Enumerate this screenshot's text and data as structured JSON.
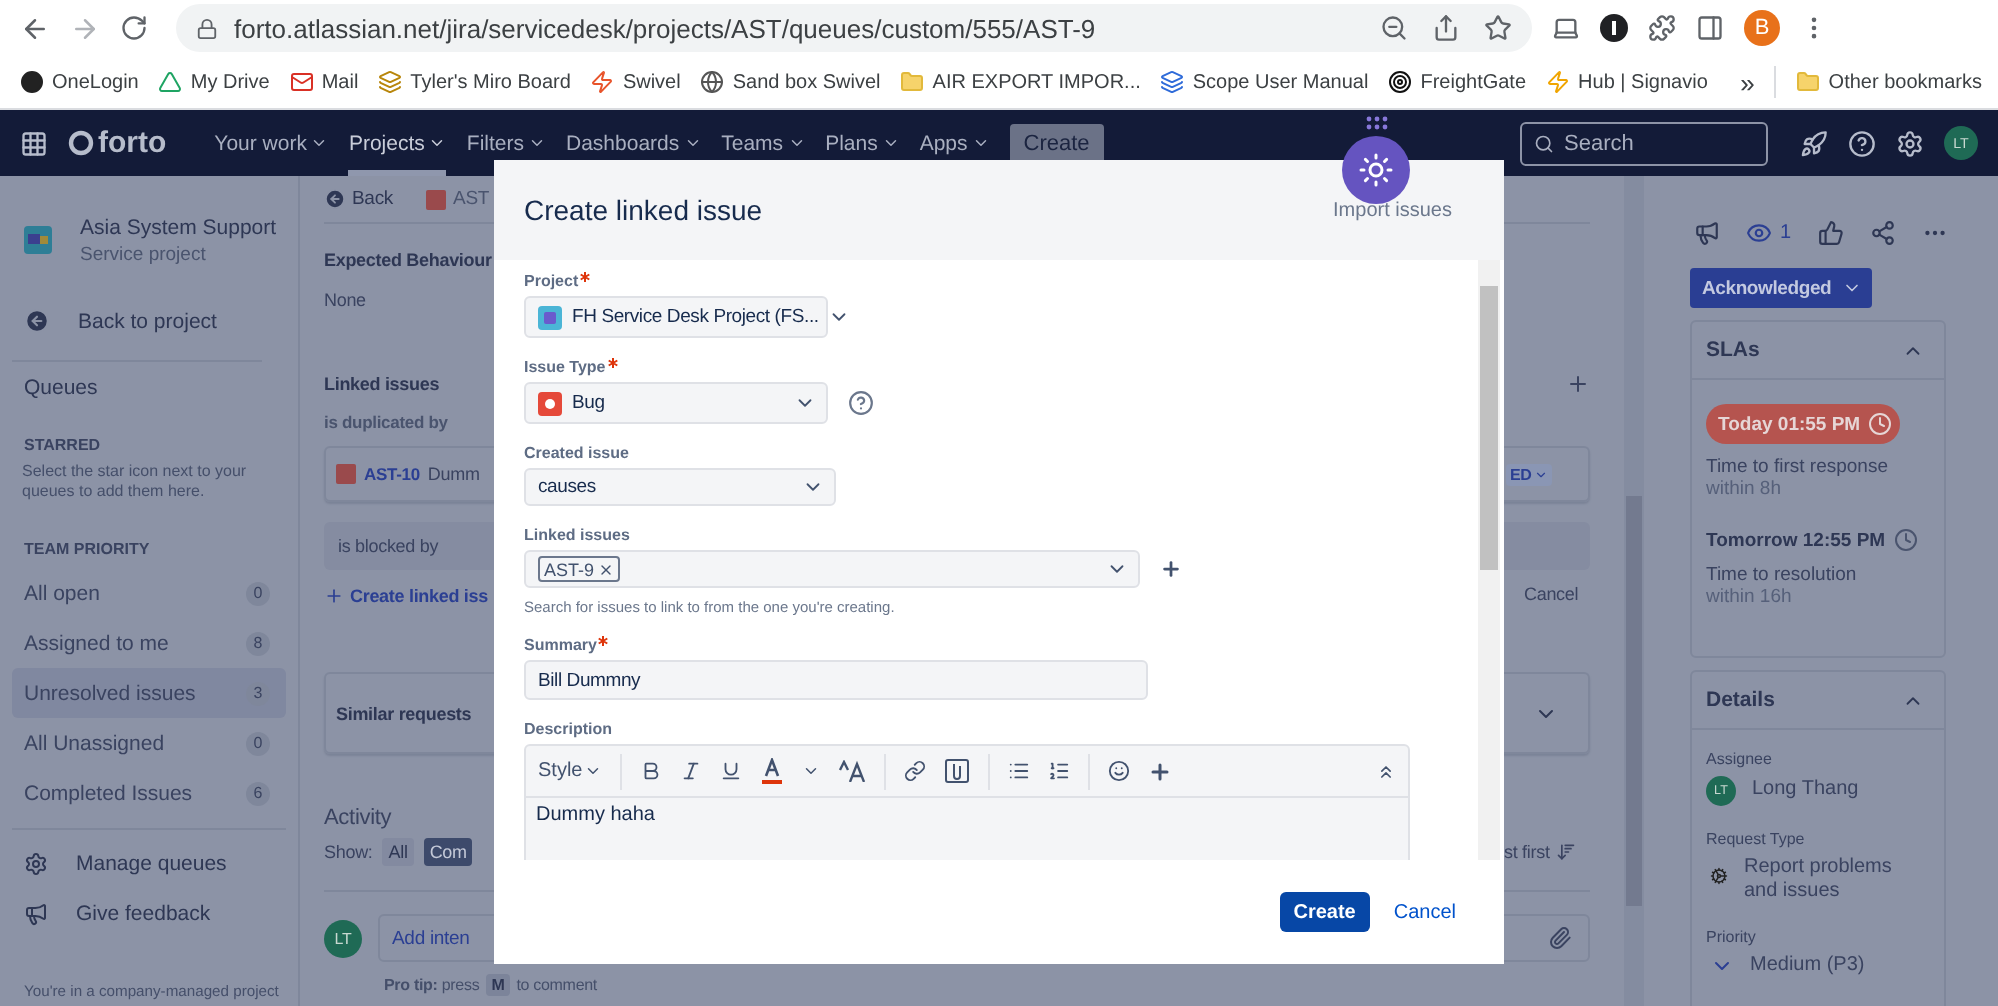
{
  "browser": {
    "url": "forto.atlassian.net/jira/servicedesk/projects/AST/queues/custom/555/AST-9",
    "profile_initial": "B",
    "bookmarks": [
      {
        "label": "OneLogin",
        "kind": "circle"
      },
      {
        "label": "My Drive",
        "kind": "drive"
      },
      {
        "label": "Mail",
        "kind": "mail"
      },
      {
        "label": "Tyler's Miro Board",
        "kind": "board"
      },
      {
        "label": "Swivel",
        "kind": "swivel"
      },
      {
        "label": "Sand box Swivel",
        "kind": "globe"
      },
      {
        "label": "AIR EXPORT IMPOR...",
        "kind": "folder"
      },
      {
        "label": "Scope User Manual",
        "kind": "scope"
      },
      {
        "label": "FreightGate",
        "kind": "target"
      },
      {
        "label": "Hub | Signavio",
        "kind": "hub"
      }
    ],
    "more": "»",
    "other_bookmarks": "Other bookmarks"
  },
  "nav": {
    "logo": "forto",
    "items": [
      {
        "label": "Your work",
        "selected": false
      },
      {
        "label": "Projects",
        "selected": true
      },
      {
        "label": "Filters",
        "selected": false
      },
      {
        "label": "Dashboards",
        "selected": false
      },
      {
        "label": "Teams",
        "selected": false
      },
      {
        "label": "Plans",
        "selected": false
      },
      {
        "label": "Apps",
        "selected": false
      }
    ],
    "create": "Create",
    "search": {
      "placeholder": "Search"
    },
    "avatar": "LT"
  },
  "sidebar": {
    "project": {
      "name": "Asia System Support",
      "type": "Service project"
    },
    "back": "Back to project",
    "queues": "Queues",
    "starred": {
      "heading": "STARRED",
      "hint": "Select the star icon next to your queues to add them here."
    },
    "team_priority": "TEAM PRIORITY",
    "queues_list": [
      {
        "label": "All open",
        "count": "0",
        "selected": false
      },
      {
        "label": "Assigned to me",
        "count": "8",
        "selected": false
      },
      {
        "label": "Unresolved issues",
        "count": "3",
        "selected": true
      },
      {
        "label": "All Unassigned",
        "count": "0",
        "selected": false
      },
      {
        "label": "Completed Issues",
        "count": "6",
        "selected": false
      }
    ],
    "footer_links": [
      {
        "label": "Manage queues",
        "kind": "gear"
      },
      {
        "label": "Give feedback",
        "kind": "megaphone"
      }
    ],
    "note": "You're in a company-managed project"
  },
  "issue": {
    "back": "Back",
    "breadcrumb": "AST",
    "expected_behaviour": {
      "label": "Expected Behaviour",
      "value": "None"
    },
    "linked_issues": {
      "heading": "Linked issues",
      "relation": "is duplicated by",
      "item": {
        "key": "AST-10",
        "summary": "Dumm",
        "status": "ED"
      },
      "new_relation": "is blocked by",
      "create_link": "Create linked iss",
      "cancel": "Cancel"
    },
    "similar_requests": "Similar requests",
    "activity": {
      "heading": "Activity",
      "show_label": "Show:",
      "filters": [
        {
          "label": "All",
          "selected": false
        },
        {
          "label": "Com",
          "selected": true
        }
      ],
      "sort": "st first",
      "avatar": "LT",
      "comment_placeholder": "Add inten",
      "pro_tip": "**Pro tip:** press",
      "key": "M",
      "pro_tip_end": "to comment"
    }
  },
  "side_panel": {
    "watchers": "1",
    "status": "Acknowledged",
    "slas": {
      "heading": "SLAs",
      "expanded": true,
      "items": [
        {
          "time": "Today 01:55 PM",
          "breached": true,
          "name": "Time to first response",
          "goal": "within 8h"
        },
        {
          "time": "Tomorrow 12:55 PM",
          "breached": false,
          "name": "Time to resolution",
          "goal": "within 16h"
        }
      ]
    },
    "details": {
      "heading": "Details",
      "expanded": true,
      "assignee": {
        "label": "Assignee",
        "initials": "LT",
        "name": "Long Thang"
      },
      "request_type": {
        "label": "Request Type",
        "value": "Report problems and issues"
      },
      "priority": {
        "label": "Priority",
        "value": "Medium (P3)"
      }
    }
  },
  "modal": {
    "title": "Create linked issue",
    "import": "Import issues",
    "fields": [
      {
        "kind": "project",
        "label": "Project",
        "required": true,
        "help": false,
        "value": "FH Service Desk Project (FS..."
      },
      {
        "kind": "issue_type",
        "label": "Issue Type",
        "required": true,
        "help": true,
        "value": "Bug"
      },
      {
        "kind": "select",
        "label": "Created issue",
        "required": false,
        "help": false,
        "value": "causes"
      },
      {
        "kind": "multi",
        "label": "Linked issues",
        "required": false,
        "help": false,
        "tags": [
          "AST-9"
        ],
        "hint": "Search for issues to link to from the one you're creating."
      },
      {
        "kind": "text",
        "label": "Summary",
        "required": true,
        "help": false,
        "value": "Bill Dummny"
      },
      {
        "kind": "editor",
        "label": "Description",
        "required": false,
        "help": false,
        "style": "Style",
        "value": "Dummy haha"
      }
    ],
    "buttons": {
      "create": "Create",
      "cancel": "Cancel"
    }
  }
}
